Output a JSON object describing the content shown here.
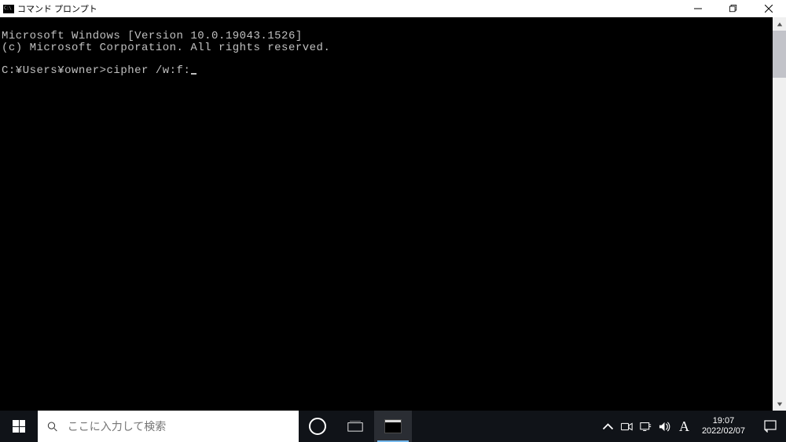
{
  "window": {
    "title": "コマンド プロンプト"
  },
  "console": {
    "line1": "Microsoft Windows [Version 10.0.19043.1526]",
    "line2": "(c) Microsoft Corporation. All rights reserved.",
    "prompt": "C:¥Users¥owner>",
    "command": "cipher /w:f:"
  },
  "taskbar": {
    "search_placeholder": "ここに入力して検索",
    "ime_mode": "A",
    "clock_time": "19:07",
    "clock_date": "2022/02/07"
  }
}
